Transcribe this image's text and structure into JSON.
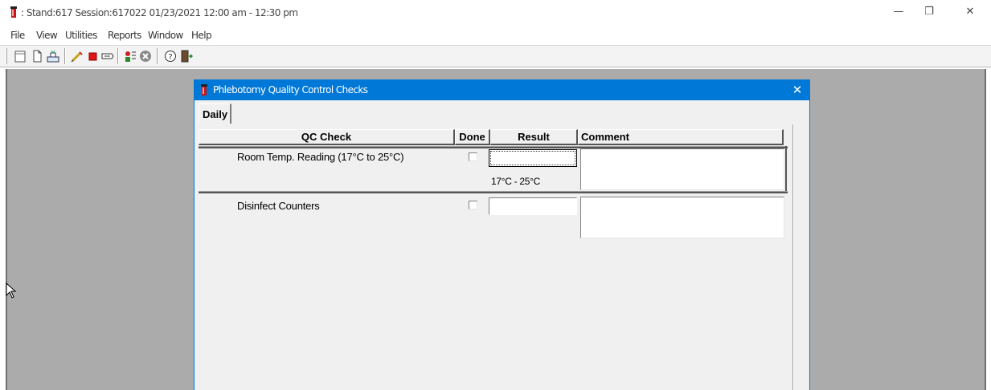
{
  "window": {
    "title": ": Stand:617 Session:617022 01/23/2021 12:00 am - 12:30 pm",
    "minimize_glyph": "—",
    "maximize_glyph": "❐",
    "close_glyph": "✕"
  },
  "menu": {
    "items": [
      "File",
      "View",
      "Utilities",
      "Reports",
      "Window",
      "Help"
    ]
  },
  "toolbar": {
    "icons": [
      "new-icon",
      "open-icon",
      "tray-icon",
      "syringe-icon",
      "stop-icon",
      "hand-pointer-icon",
      "patient-icon",
      "cancel-icon",
      "help-icon",
      "exit-icon"
    ]
  },
  "dialog": {
    "title": "Phlebotomy Quality Control Checks",
    "close_glyph": "✕",
    "tab_label": "Daily",
    "columns": {
      "qc_check": "QC Check",
      "done": "Done",
      "result": "Result",
      "comment": "Comment"
    },
    "rows": [
      {
        "label": "Room Temp. Reading (17°C to 25°C)",
        "done": false,
        "result": "",
        "range": "17°C - 25°C",
        "comment": ""
      },
      {
        "label": "Disinfect Counters",
        "done": false,
        "result": "",
        "range": "",
        "comment": ""
      }
    ]
  },
  "colors": {
    "dialog_title_bg": "#0078d7",
    "workspace_bg": "#ababab",
    "dialog_bg": "#f0f0f0"
  }
}
